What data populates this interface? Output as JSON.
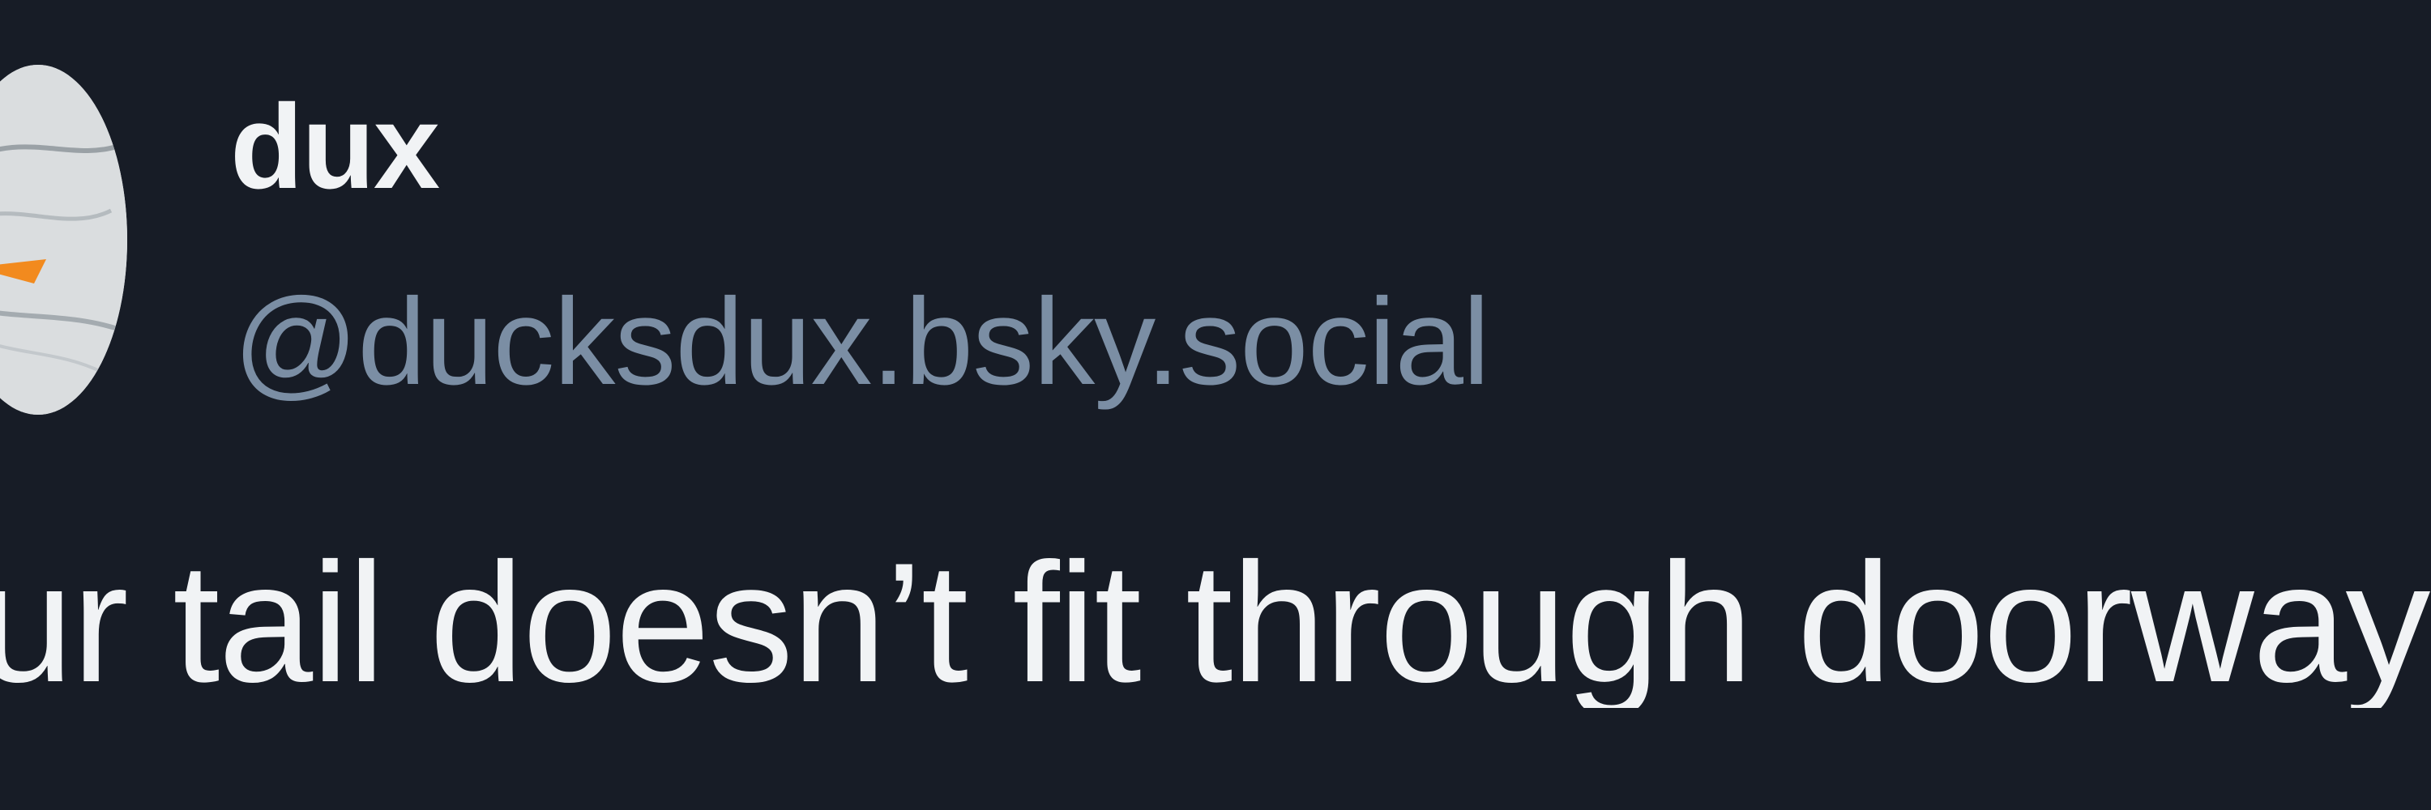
{
  "post": {
    "author": {
      "display_name": "dux",
      "handle": "@ducksdux.bsky.social",
      "avatar_icon": "duck-avatar-icon"
    },
    "text": "ur tail doesn’t fit through doorway"
  },
  "colors": {
    "background": "#171c26",
    "display_name": "#f1f3f5",
    "handle": "#7b8ea4",
    "post_text": "#f1f3f5",
    "avatar_accent": "#f28a1e"
  }
}
